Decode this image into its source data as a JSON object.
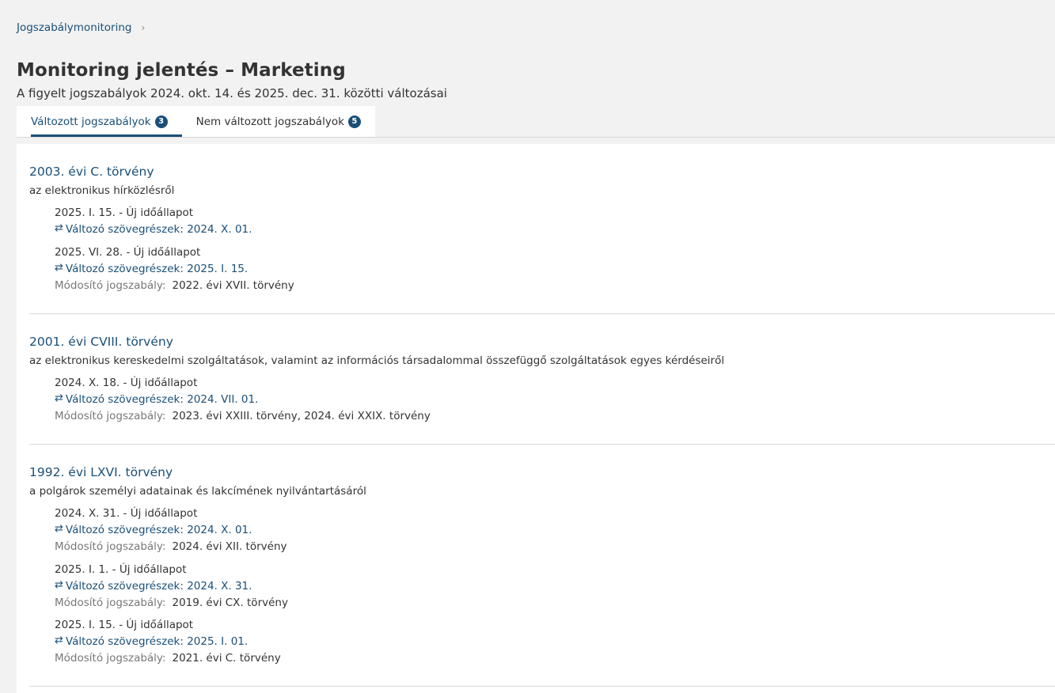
{
  "breadcrumb": {
    "item": "Jogszabálymonitoring",
    "separator": "›"
  },
  "page": {
    "title": "Monitoring jelentés – Marketing",
    "subtitle": "A figyelt jogszabályok 2024. okt. 14. és 2025. dec. 31. közötti változásai"
  },
  "tabs": [
    {
      "label": "Változott jogszabályok",
      "count": "3",
      "active": true
    },
    {
      "label": "Nem változott jogszabályok",
      "count": "5",
      "active": false
    }
  ],
  "icons": {
    "change": "swap-arrows-icon"
  },
  "colors": {
    "accent": "#1a4f78",
    "text": "#333333",
    "muted": "#777777"
  },
  "laws": [
    {
      "title": "2003. évi C. törvény",
      "description": "az elektronikus hírközlésről",
      "entries": [
        {
          "state": "2025. I. 15. - Új időállapot",
          "change": "Változó szövegrészek: 2024. X. 01."
        },
        {
          "state": "2025. VI. 28. - Új időállapot",
          "change": "Változó szövegrészek: 2025. I. 15.",
          "modifier_label": "Módosító jogszabály:",
          "modifier": "2022. évi XVII. törvény"
        }
      ]
    },
    {
      "title": "2001. évi CVIII. törvény",
      "description": "az elektronikus kereskedelmi szolgáltatások, valamint az információs társadalommal összefüggő szolgáltatások egyes kérdéseiről",
      "entries": [
        {
          "state": "2024. X. 18. - Új időállapot",
          "change": "Változó szövegrészek: 2024. VII. 01.",
          "modifier_label": "Módosító jogszabály:",
          "modifier": "2023. évi XXIII. törvény,  2024. évi XXIX. törvény"
        }
      ]
    },
    {
      "title": "1992. évi LXVI. törvény",
      "description": "a polgárok személyi adatainak és lakcímének nyilvántartásáról",
      "entries": [
        {
          "state": "2024. X. 31. - Új időállapot",
          "change": "Változó szövegrészek: 2024. X. 01.",
          "modifier_label": "Módosító jogszabály:",
          "modifier": "2024. évi XII. törvény"
        },
        {
          "state": "2025. I. 1. - Új időállapot",
          "change": "Változó szövegrészek: 2024. X. 31.",
          "modifier_label": "Módosító jogszabály:",
          "modifier": "2019. évi CX. törvény"
        },
        {
          "state": "2025. I. 15. - Új időállapot",
          "change": "Változó szövegrészek: 2025. I. 01.",
          "modifier_label": "Módosító jogszabály:",
          "modifier": "2021. évi C. törvény"
        }
      ]
    }
  ]
}
